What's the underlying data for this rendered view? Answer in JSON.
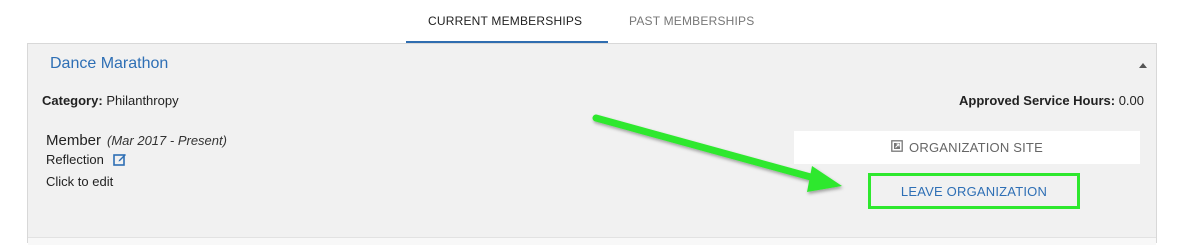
{
  "tabs": {
    "current": "CURRENT MEMBERSHIPS",
    "past": "PAST MEMBERSHIPS"
  },
  "organization": {
    "name": "Dance Marathon",
    "category_label": "Category:",
    "category_value": "Philanthropy",
    "hours_label": "Approved Service Hours:",
    "hours_value": "0.00",
    "position": {
      "role": "Member",
      "dates": "(Mar 2017 - Present)",
      "reflection_label": "Reflection",
      "click_to_edit": "Click to edit"
    },
    "actions": {
      "organization_site": "ORGANIZATION SITE",
      "leave_organization": "LEAVE ORGANIZATION"
    }
  },
  "icons": {
    "edit": "edit-icon",
    "external_link": "external-link-icon",
    "collapse": "caret-up-icon"
  },
  "colors": {
    "accent_blue": "#2e6fb5",
    "tab_underline": "#2f6db0",
    "annotation_green": "#2ee82e"
  }
}
